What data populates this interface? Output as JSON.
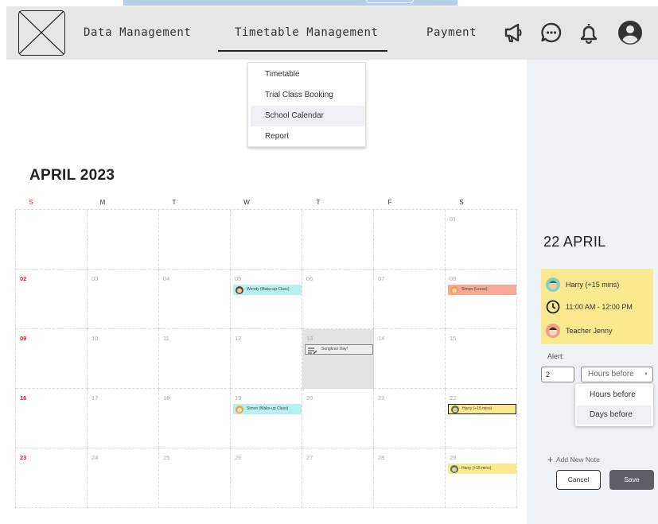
{
  "nav": {
    "items": [
      "Data Management",
      "Timetable Management",
      "Payment"
    ],
    "active": "Timetable Management",
    "icons": [
      "megaphone-icon",
      "chat-icon",
      "bell-icon",
      "account-icon"
    ]
  },
  "dropdown": {
    "items": [
      "Timetable",
      "Trial Class Booking",
      "School Calendar",
      "Report"
    ],
    "active": "School Calendar"
  },
  "calendar": {
    "title": "APRIL 2023",
    "weekdays": [
      "S",
      "M",
      "T",
      "W",
      "T",
      "F",
      "S"
    ],
    "weeks": [
      [
        "",
        "",
        "",
        "",
        "",
        "",
        "01"
      ],
      [
        "02",
        "03",
        "04",
        "05",
        "06",
        "07",
        "08"
      ],
      [
        "09",
        "10",
        "11",
        "12",
        "13",
        "14",
        "15"
      ],
      [
        "16",
        "17",
        "18",
        "19",
        "20",
        "21",
        "22"
      ],
      [
        "23",
        "24",
        "25",
        "26",
        "27",
        "28",
        "29"
      ]
    ],
    "highlighted_day": "13",
    "events": {
      "wendy": "Wendy (Make-up Class)",
      "simon_leave": "Simon (Leave)",
      "songkran": "Songkran Day!",
      "simon_makeup": "Simon (Make-up Class)",
      "harry_22": "Harry (+15 mins)",
      "harry_29": "Harry (+15 mins)"
    },
    "colors": {
      "makeup": "#b7f0f0",
      "leave": "#f5aa96",
      "extended": "#fbe98f",
      "holiday": "#e3e3e3",
      "sunday": "#e02020"
    }
  },
  "side": {
    "date": "22 APRIL",
    "student": "Harry (+15 mins)",
    "time": "11:00 AM - 12:00 PM",
    "teacher": "Teacher Jenny",
    "alert_label": "Alert:",
    "alert_value": "2",
    "alert_unit": "Hours before",
    "alert_options": [
      "Hours before",
      "Days before"
    ],
    "add_note": "Add New Note",
    "cancel": "Cancel",
    "save": "Save"
  }
}
